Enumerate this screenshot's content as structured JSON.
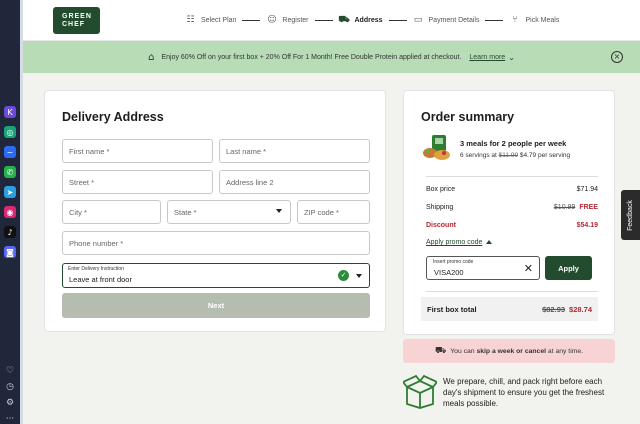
{
  "sidebar": {
    "icons": [
      {
        "name": "kite-icon",
        "glyph": "K",
        "color": "#6c4bd8"
      },
      {
        "name": "chatgpt-icon",
        "glyph": "◎",
        "color": "#1aa37a"
      },
      {
        "name": "messenger-icon",
        "glyph": "~",
        "color": "#2b6bf3"
      },
      {
        "name": "whatsapp-icon",
        "glyph": "✆",
        "color": "#25b24a"
      },
      {
        "name": "telegram-icon",
        "glyph": "➤",
        "color": "#2a9ee0"
      },
      {
        "name": "instagram-icon",
        "glyph": "◉",
        "color": "#d62976"
      },
      {
        "name": "tiktok-icon",
        "glyph": "♪",
        "color": "#111111"
      },
      {
        "name": "discord-icon",
        "glyph": "◙",
        "color": "#5865f2"
      }
    ],
    "bottom_icons": [
      {
        "name": "heart-icon",
        "glyph": "♡"
      },
      {
        "name": "clock-icon",
        "glyph": "◷"
      },
      {
        "name": "gear-icon",
        "glyph": "⚙"
      },
      {
        "name": "more-icon",
        "glyph": "···"
      }
    ]
  },
  "header": {
    "logo_line1": "GREEN",
    "logo_line2": "CHEF",
    "steps": [
      {
        "label": "Select Plan",
        "icon": "☷",
        "active": false
      },
      {
        "label": "Register",
        "icon": "☺",
        "active": false
      },
      {
        "label": "Address",
        "icon": "⛟",
        "active": true
      },
      {
        "label": "Payment Details",
        "icon": "▭",
        "active": false
      },
      {
        "label": "Pick Meals",
        "icon": "⑂",
        "active": false
      }
    ]
  },
  "banner": {
    "text": "Enjoy 60% Off on your first box + 20% Off For 1 Month! Free Double Protein applied at checkout.",
    "link": "Learn more"
  },
  "delivery": {
    "title": "Delivery Address",
    "fields": {
      "first_name": "First name *",
      "last_name": "Last name *",
      "street": "Street *",
      "address2": "Address line 2",
      "city": "City *",
      "state": "State *",
      "zip": "ZIP code *",
      "phone": "Phone number *"
    },
    "instruction_label": "Enter Delivery Instruction",
    "instruction_value": "Leave at front door",
    "next_label": "Next"
  },
  "summary": {
    "title": "Order summary",
    "meal_title": "3 meals for 2 people per week",
    "meal_servings": "6 servings at",
    "meal_old_price": "$11.99",
    "meal_new_price": "$4.79 per serving",
    "box_price_label": "Box price",
    "box_price": "$71.94",
    "shipping_label": "Shipping",
    "shipping_old": "$10.99",
    "shipping_new": "FREE",
    "discount_label": "Discount",
    "discount": "$54.19",
    "promo_link": "Apply promo code",
    "promo_input_label": "Insert promo code",
    "promo_value": "VISA200",
    "apply_label": "Apply",
    "total_label": "First box total",
    "total_old": "$82.93",
    "total_new": "$28.74"
  },
  "skip": {
    "prefix": "You can",
    "bold": "skip a week or cancel",
    "suffix": "at any time."
  },
  "info": {
    "text": "We prepare, chill, and pack right before each day's shipment to ensure you get the freshest meals possible."
  },
  "feedback_label": "Feedback"
}
